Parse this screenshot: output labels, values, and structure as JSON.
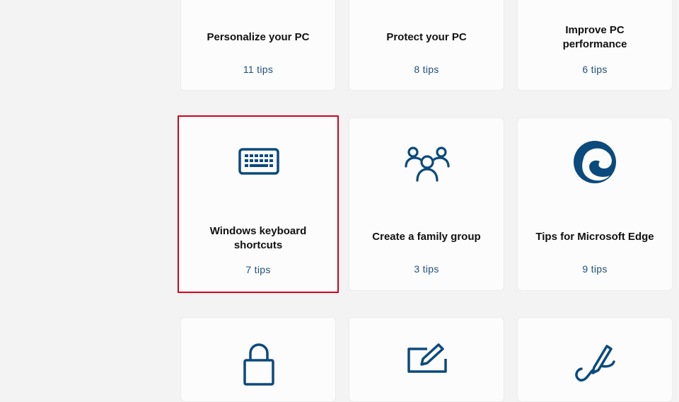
{
  "accent_color": "#0b4a7d",
  "highlight_color": "#d0021b",
  "cards": [
    {
      "title": "Personalize your PC",
      "count": "11 tips",
      "icon": null
    },
    {
      "title": "Protect your PC",
      "count": "8 tips",
      "icon": null
    },
    {
      "title": "Improve PC performance",
      "count": "6 tips",
      "icon": null
    },
    {
      "title": "Windows keyboard shortcuts",
      "count": "7 tips",
      "icon": "keyboard-icon",
      "selected": true
    },
    {
      "title": "Create a family group",
      "count": "3 tips",
      "icon": "family-group-icon"
    },
    {
      "title": "Tips for Microsoft Edge",
      "count": "9 tips",
      "icon": "edge-icon"
    },
    {
      "title": "",
      "count": "",
      "icon": "lock-icon"
    },
    {
      "title": "",
      "count": "",
      "icon": "pen-pad-icon"
    },
    {
      "title": "",
      "count": "",
      "icon": "pen-signature-icon"
    }
  ]
}
